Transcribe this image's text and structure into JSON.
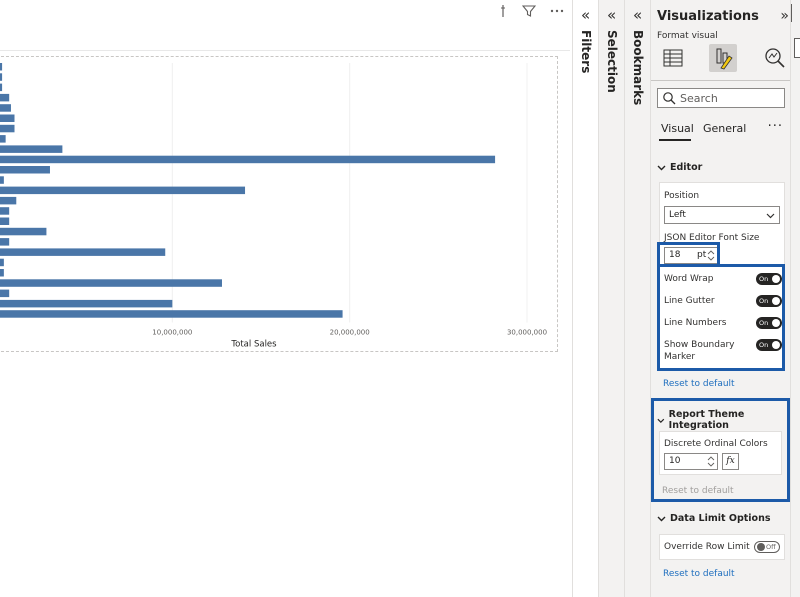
{
  "canvas": {
    "header_icons": [
      "focus-mode-icon",
      "filter-icon",
      "more-options-icon"
    ]
  },
  "chart_data": {
    "type": "bar",
    "orientation": "horizontal",
    "title": "",
    "xlabel": "Total Sales",
    "ylabel": "",
    "xlim": [
      0,
      30000000
    ],
    "x_tick_labels": [
      "10,000,000",
      "20,000,000",
      "30,000,000"
    ],
    "x_ticks": [
      10000000,
      20000000,
      30000000
    ],
    "values": [
      400000,
      400000,
      400000,
      800000,
      900000,
      1100000,
      1100000,
      600000,
      3800000,
      28200000,
      3100000,
      500000,
      14100000,
      1200000,
      800000,
      800000,
      2900000,
      800000,
      9600000,
      500000,
      500000,
      12800000,
      800000,
      10000000,
      19600000
    ],
    "bar_color": "#4a76a8",
    "grid": true
  },
  "panes": {
    "filters_label": "Filters",
    "selection_label": "Selection",
    "bookmarks_label": "Bookmarks",
    "collapse_chevron": "«",
    "expand_chevron": "»"
  },
  "visualizations": {
    "title": "Visualizations",
    "format_visual_label": "Format visual",
    "search_placeholder": "Search",
    "tab_visual": "Visual",
    "tab_general": "General",
    "more": "···",
    "editor": {
      "heading": "Editor",
      "position_label": "Position",
      "position_value": "Left",
      "font_size_label": "JSON Editor Font Size",
      "font_size_value": "18",
      "font_size_unit": "pt",
      "word_wrap_label": "Word Wrap",
      "word_wrap_state": "On",
      "line_gutter_label": "Line Gutter",
      "line_gutter_state": "On",
      "line_numbers_label": "Line Numbers",
      "line_numbers_state": "On",
      "show_boundary_label": "Show Boundary Marker",
      "show_boundary_state": "On",
      "reset": "Reset to default"
    },
    "theme": {
      "heading": "Report Theme Integration",
      "discrete_label": "Discrete Ordinal Colors",
      "discrete_value": "10",
      "fx": "fx",
      "reset": "Reset to default"
    },
    "data_limit": {
      "heading": "Data Limit Options",
      "override_label": "Override Row Limit",
      "override_state": "Off",
      "reset": "Reset to default"
    }
  },
  "colors": {
    "highlight": "#1c5aa8",
    "pane_bg": "#f3f2f1",
    "link": "#1f6fbf"
  }
}
